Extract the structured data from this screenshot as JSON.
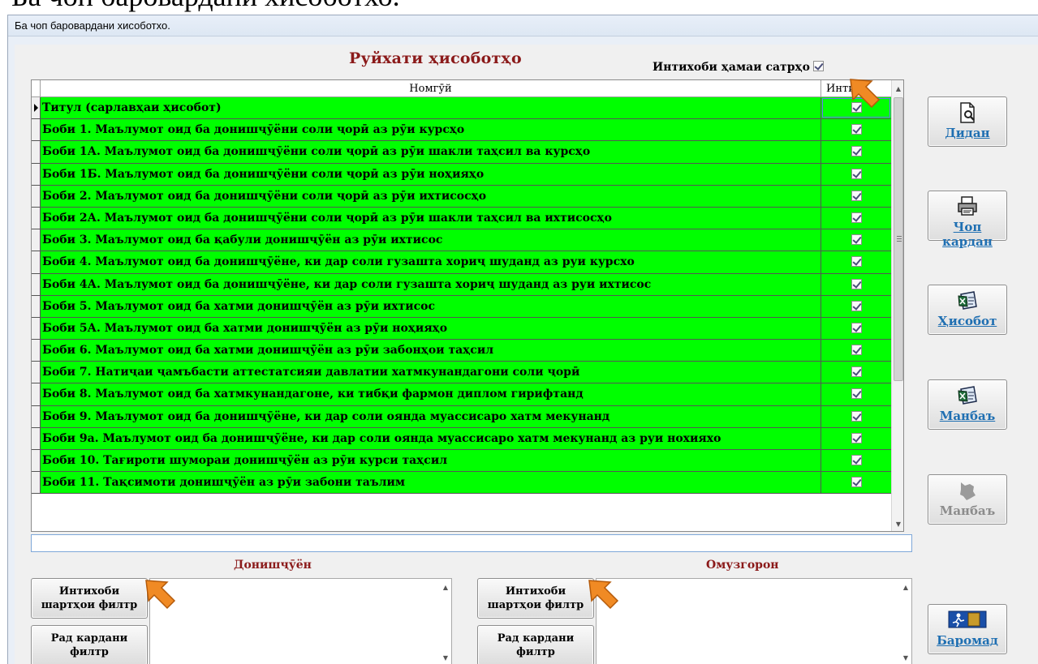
{
  "doc_header_text": "Ба чоп баровардани хисоботхо.",
  "window": {
    "title": "Ба чоп баровардани хисоботхо."
  },
  "heading": "Руйхати ҳисоботҳо",
  "select_all": {
    "label": "Интихоби ҳамаи сатрҳо",
    "checked": true
  },
  "grid": {
    "columns": [
      "Номгӯй",
      "Интих"
    ],
    "rows": [
      {
        "name": "Титул (сарлавҳаи ҳисобот)",
        "selected": true
      },
      {
        "name": "Боби 1. Маълумот оид ба донишҷӯёни соли ҷорӣ аз рӯи курсҳо",
        "selected": true
      },
      {
        "name": "Боби 1А. Маълумот оид ба донишҷӯёни соли ҷорӣ аз рӯи шакли таҳсил ва курсҳо",
        "selected": true
      },
      {
        "name": "Боби 1Б. Маълумот оид ба донишҷӯёни соли ҷорӣ аз рӯи ноҳияҳо",
        "selected": true
      },
      {
        "name": "Боби 2. Маълумот оид ба донишҷӯёни соли ҷорӣ аз рӯи ихтисосҳо",
        "selected": true
      },
      {
        "name": "Боби 2А. Маълумот оид ба донишҷӯёни соли ҷорӣ аз рӯи шакли таҳсил ва ихтисосҳо",
        "selected": true
      },
      {
        "name": "Боби 3. Маълумот оид ба қабули донишҷӯён аз рӯи ихтисос",
        "selected": true
      },
      {
        "name": "Боби 4. Маълумот оид ба донишҷӯёне, ки дар соли гузашта хориҷ шуданд аз руи курсхо",
        "selected": true
      },
      {
        "name": "Боби 4А. Маълумот оид ба донишҷӯёне, ки дар соли гузашта хориҷ шуданд аз руи ихтисос",
        "selected": true
      },
      {
        "name": "Боби 5. Маълумот оид ба хатми донишҷӯён аз рӯи ихтисос",
        "selected": true
      },
      {
        "name": "Боби 5А. Маълумот оид ба хатми донишҷӯён аз рӯи ноҳияҳо",
        "selected": true
      },
      {
        "name": "Боби 6. Маълумот оид ба хатми донишҷӯён аз рӯи забонҳои таҳсил",
        "selected": true
      },
      {
        "name": "Боби 7. Натиҷаи ҷамъбасти аттестатсияи давлатии хатмкунандагони соли ҷорӣ",
        "selected": true
      },
      {
        "name": "Боби 8. Маълумот оид ба хатмкунандагоне, ки тибқи фармон диплом гирифтанд",
        "selected": true
      },
      {
        "name": "Боби 9. Маълумот оид ба донишҷӯёне, ки  дар соли оянда муассисаро хатм мекунанд",
        "selected": true
      },
      {
        "name": "Боби 9а. Маълумот оид ба донишҷӯёне, ки  дар соли оянда муассисаро хатм мекунанд аз руи нохияхо",
        "selected": true
      },
      {
        "name": "Боби 10. Тағироти шумораи донишҷӯён аз рӯи курси таҳсил",
        "selected": true
      },
      {
        "name": "Боби 11. Тақсимоти донишҷӯён аз рӯи забони таълим",
        "selected": true
      }
    ]
  },
  "students": {
    "label": "Донишҷӯён",
    "filter_button": "Интихоби шартҳои филтр",
    "clear_button": "Рад кардани филтр"
  },
  "teachers": {
    "label": "Омузгорон",
    "filter_button": "Интихоби шартҳои филтр",
    "clear_button": "Рад кардани филтр"
  },
  "side_buttons": {
    "view": {
      "label": "Дидан",
      "icon": "preview-icon"
    },
    "print": {
      "label": "Чоп кардан",
      "icon": "printer-icon"
    },
    "report": {
      "label": "Ҳисобот",
      "icon": "excel-icon"
    },
    "source": {
      "label": "Манбаъ",
      "icon": "excel-icon"
    },
    "source_disabled": {
      "label": "Манбаъ",
      "icon": "map-icon"
    },
    "exit": {
      "label": "Баромад",
      "icon": "exit-door-icon"
    }
  },
  "colors": {
    "row_bg": "#00ff00",
    "heading": "#8b1a1a",
    "side_label": "#1f6fb2",
    "pointer": "#f08a24"
  }
}
